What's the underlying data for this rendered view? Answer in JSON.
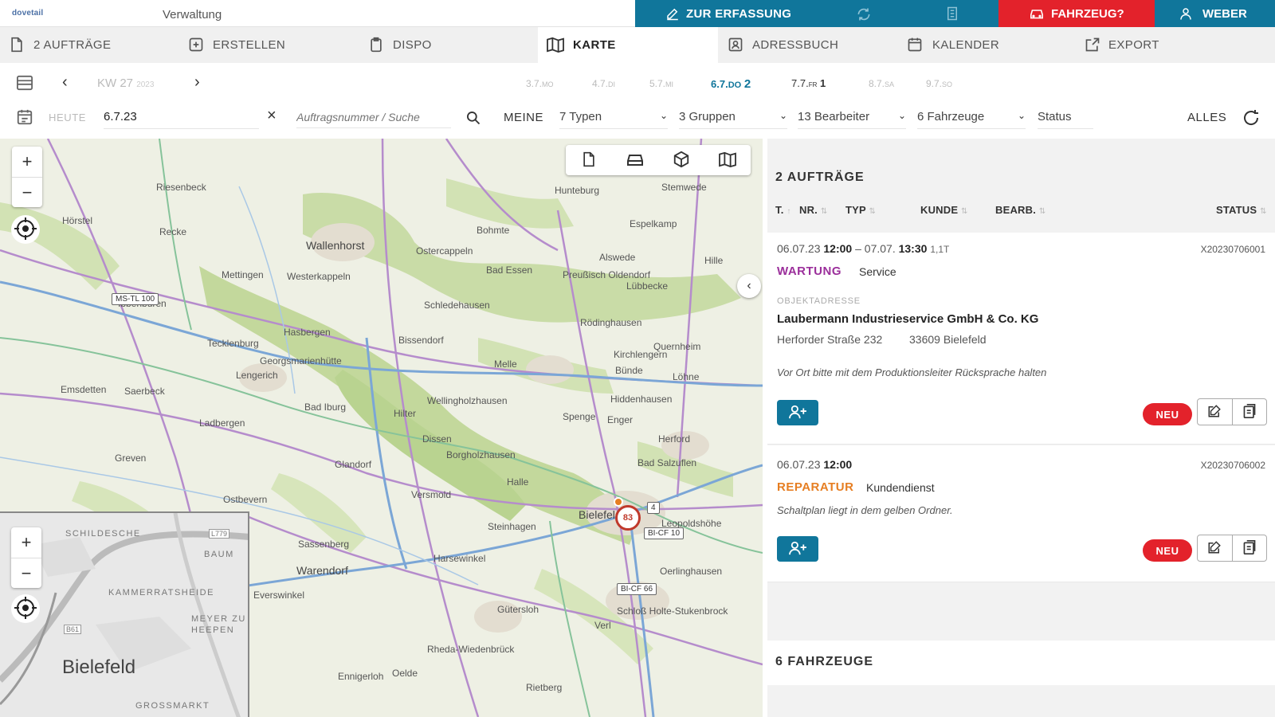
{
  "topbar": {
    "logo": "dovetail",
    "app_title": "Verwaltung",
    "erfassung_label": "ZUR ERFASSUNG",
    "fahrzeug_label": "FAHRZEUG?",
    "user_label": "WEBER"
  },
  "nav": {
    "tabs": [
      {
        "label": "2 AUFTRÄGE"
      },
      {
        "label": "ERSTELLEN"
      },
      {
        "label": "DISPO"
      },
      {
        "label": "KARTE"
      },
      {
        "label": "ADRESSBUCH"
      },
      {
        "label": "KALENDER"
      },
      {
        "label": "EXPORT"
      }
    ]
  },
  "week": {
    "kw": "KW 27",
    "year": "2023",
    "days": [
      {
        "label": "3.7.",
        "dow": "MO",
        "count": ""
      },
      {
        "label": "4.7.",
        "dow": "DI",
        "count": ""
      },
      {
        "label": "5.7.",
        "dow": "MI",
        "count": ""
      },
      {
        "label": "6.7.",
        "dow": "DO",
        "count": "2"
      },
      {
        "label": "7.7.",
        "dow": "FR",
        "count": "1"
      },
      {
        "label": "8.7.",
        "dow": "SA",
        "count": ""
      },
      {
        "label": "9.7.",
        "dow": "SO",
        "count": ""
      }
    ]
  },
  "filters": {
    "heute": "HEUTE",
    "date": "6.7.23",
    "search_placeholder": "Auftragsnummer / Suche",
    "meine": "MEINE",
    "typen": "7 Typen",
    "gruppen": "3 Gruppen",
    "bearbeiter": "13 Bearbeiter",
    "fahrzeuge": "6 Fahrzeuge",
    "status": "Status",
    "alles": "ALLES"
  },
  "map": {
    "labels": [
      "Lengerich",
      "Wallenhorst",
      "Ostercappeln",
      "Bad Essen",
      "Lübbecke",
      "Espelkamp",
      "Melle",
      "Bünde",
      "Herford",
      "Bad Salzuflen",
      "Bielefeld",
      "Halle",
      "Oerlinghausen",
      "Warendorf",
      "Gütersloh",
      "Rheda-Wiedenbrück",
      "Harsewinkel",
      "Steinhagen",
      "Versmold",
      "Borgholzhausen",
      "Dissen",
      "Hilter",
      "Bad Iburg",
      "Georgsmarienhütte",
      "Hasbergen",
      "Tecklenburg",
      "Ibbenbüren",
      "Mettingen",
      "Westerkappeln",
      "Bohmte",
      "Preußisch Oldendorf",
      "Rödinghausen",
      "Kirchlengern",
      "Spenge",
      "Enger",
      "Hiddenhausen",
      "Löhne",
      "Ladbergen",
      "Emsdetten",
      "Greven",
      "Saerbeck",
      "Glandorf",
      "Ostbevern",
      "Sassenberg",
      "Everswinkel",
      "Ennigerloh",
      "Oelde",
      "Rietberg",
      "Verl",
      "Schloß Holte-Stukenbrock",
      "Leopoldshöhe",
      "Hörstel",
      "Recke",
      "Riesenbeck",
      "Bissendorf",
      "Schledehausen",
      "Hunteburg",
      "Alswede",
      "Hille",
      "Quernheim",
      "Wellingholzhausen",
      "Stemwede"
    ],
    "plates": [
      "MS-TL 100",
      "BI-CF 10",
      "BI-CF 66",
      "4"
    ],
    "marker_count": "83",
    "minimap": {
      "city": "Bielefeld",
      "labels": [
        "SCHILDESCHE",
        "BAUM",
        "KAMMERRATSHEIDE",
        "MEYER ZU HEEPEN",
        "GROSSMARKT",
        "L779",
        "B61"
      ]
    }
  },
  "panel": {
    "orders_title": "2 AUFTRÄGE",
    "columns": {
      "t": "T.",
      "t_sort": "↑",
      "nr": "NR.",
      "typ": "TYP",
      "kunde": "KUNDE",
      "bearb": "BEARB.",
      "status": "STATUS"
    },
    "orders": [
      {
        "date_start": "06.07.23",
        "time_start": "12:00",
        "date_end": "07.07.",
        "time_end": "13:30",
        "duration": "1,1T",
        "nr": "X20230706001",
        "typ": "WARTUNG",
        "typ_color": "#9b2f9b",
        "subtyp": "Service",
        "obj_label": "OBJEKTADRESSE",
        "company": "Laubermann Industrieservice GmbH & Co. KG",
        "street": "Herforder Straße 232",
        "city": "33609 Bielefeld",
        "note": "Vor Ort bitte mit dem Produktionsleiter Rücksprache halten",
        "badge": "NEU"
      },
      {
        "date_start": "06.07.23",
        "time_start": "12:00",
        "nr": "X20230706002",
        "typ": "REPARATUR",
        "typ_color": "#e67e22",
        "subtyp": "Kundendienst",
        "note": "Schaltplan liegt in dem gelben Ordner.",
        "badge": "NEU"
      }
    ],
    "vehicles_title": "6 FAHRZEUGE"
  },
  "colors": {
    "teal": "#10769b",
    "red": "#e3222b"
  }
}
